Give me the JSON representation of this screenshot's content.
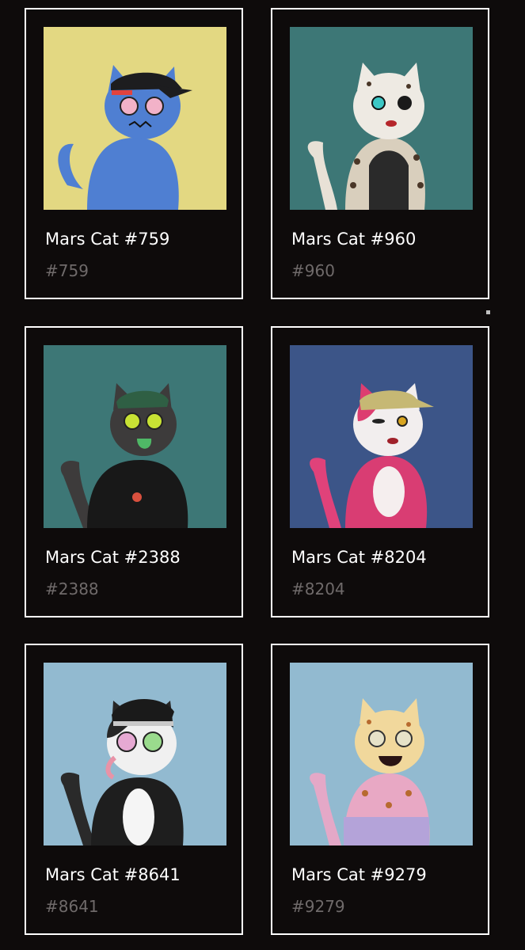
{
  "cards": [
    {
      "title": "Mars Cat #759",
      "id": "#759",
      "bg": "#e3d882"
    },
    {
      "title": "Mars Cat #960",
      "id": "#960",
      "bg": "#3d7776"
    },
    {
      "title": "Mars Cat #2388",
      "id": "#2388",
      "bg": "#3d7776"
    },
    {
      "title": "Mars Cat #8204",
      "id": "#8204",
      "bg": "#3c5588"
    },
    {
      "title": "Mars Cat #8641",
      "id": "#8641",
      "bg": "#92bad0"
    },
    {
      "title": "Mars Cat #9279",
      "id": "#9279",
      "bg": "#92bad0"
    }
  ]
}
